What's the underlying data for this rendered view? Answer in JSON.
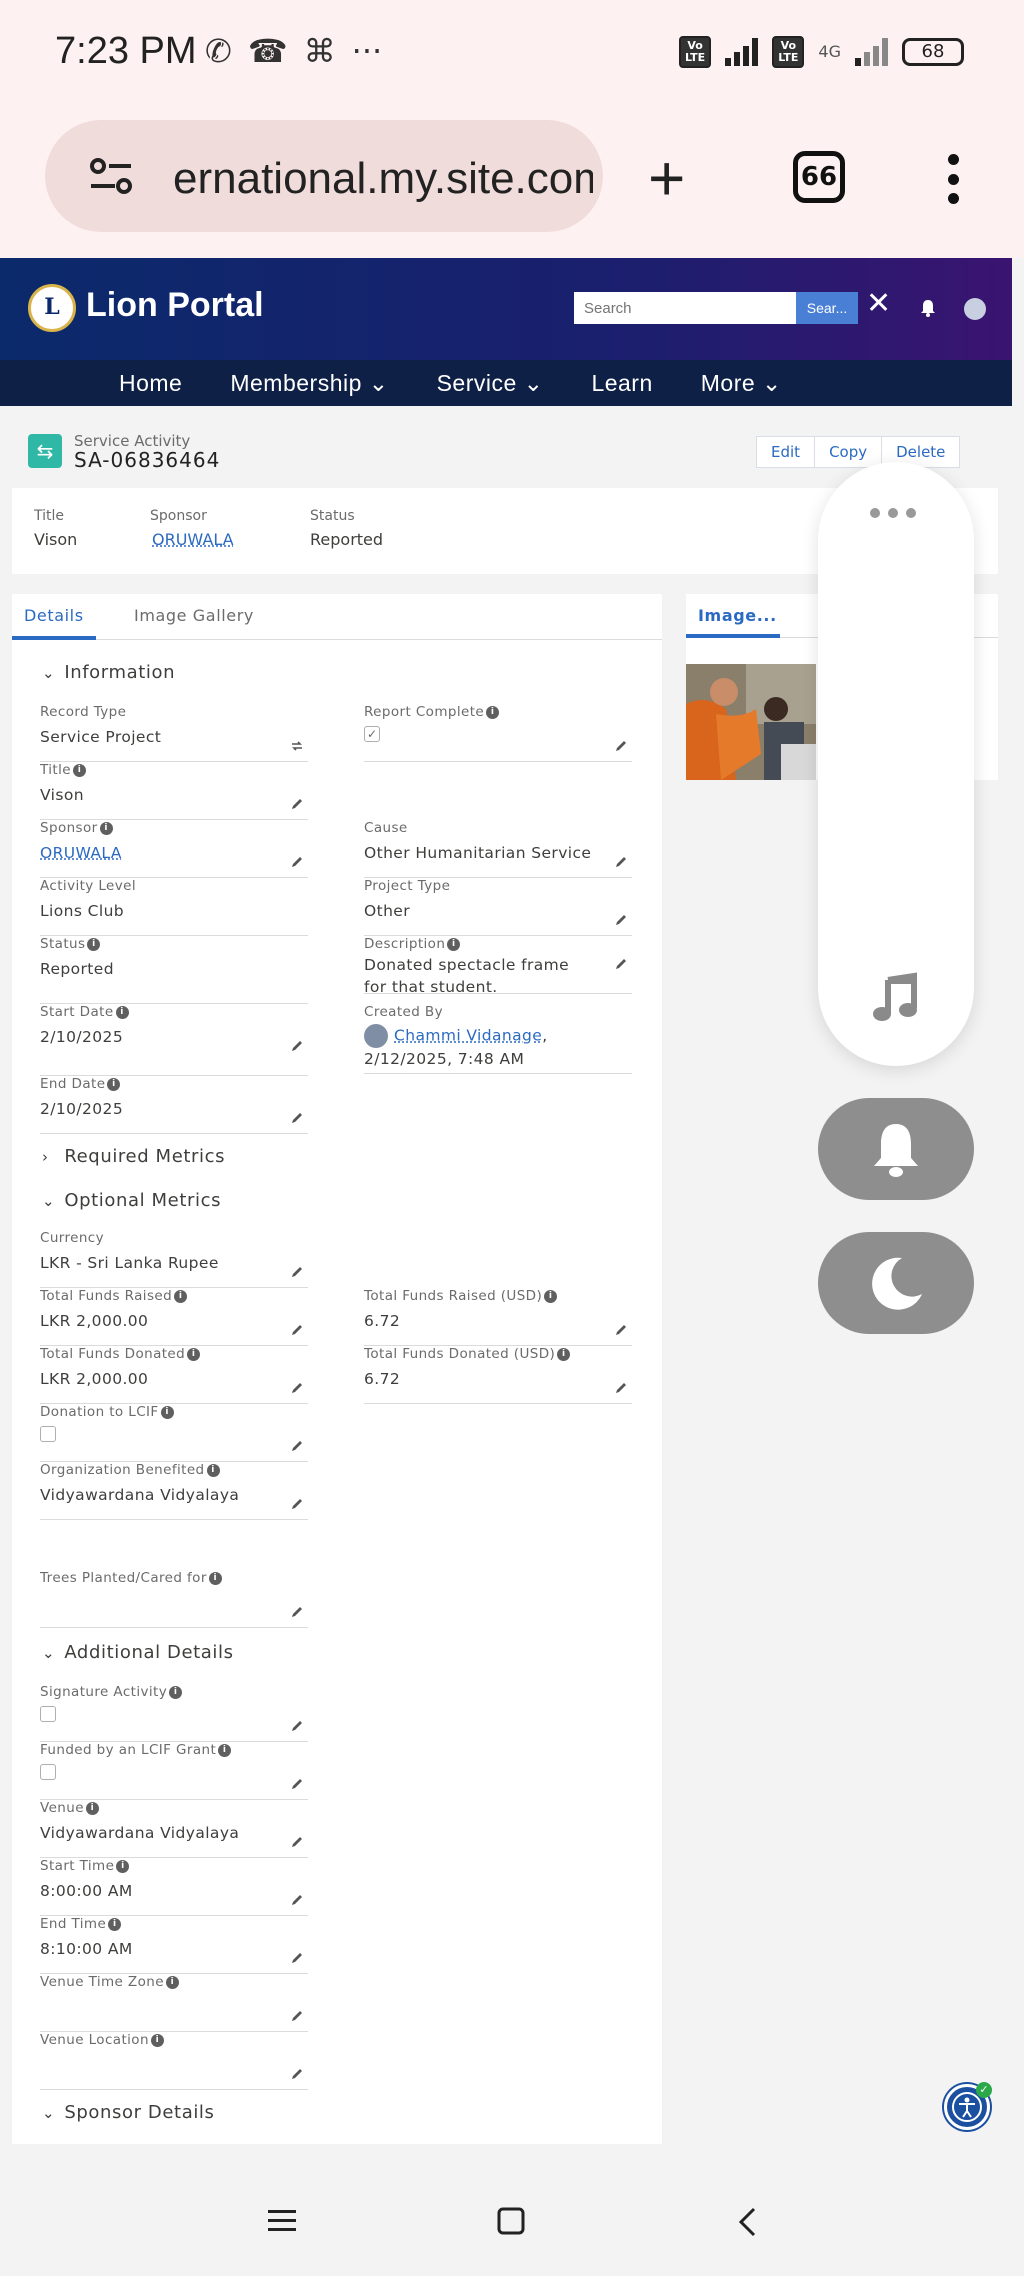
{
  "status_bar": {
    "time": "7:23 PM",
    "battery": "68",
    "network_label": "4G",
    "volte": "Vo LTE"
  },
  "browser": {
    "url": "ernational.my.site.com",
    "tab_count": "66",
    "icons": [
      "tune-icon",
      "plus-icon",
      "tabs-icon",
      "kebab-menu-icon"
    ]
  },
  "portal": {
    "logo_text": "Lion Portal",
    "search_placeholder": "Search",
    "search_button": "Sear...",
    "nav": [
      "Home",
      "Membership ⌄",
      "Service ⌄",
      "Learn",
      "More ⌄"
    ]
  },
  "record": {
    "type": "Service Activity",
    "name": "SA-06836464",
    "actions": [
      "Edit",
      "Copy",
      "Delete"
    ],
    "highlights": [
      {
        "label": "Title",
        "value": "Vison"
      },
      {
        "label": "Sponsor",
        "value": "ORUWALA"
      },
      {
        "label": "Status",
        "value": "Reported"
      }
    ]
  },
  "tabs": {
    "details": "Details",
    "gallery": "Image Gallery",
    "image_panel": "Image..."
  },
  "sections": {
    "information": "Information",
    "required": "Required Metrics",
    "optional": "Optional Metrics",
    "additional": "Additional Details",
    "sponsor": "Sponsor Details"
  },
  "fields": {
    "record_type": {
      "label": "Record Type",
      "value": "Service Project"
    },
    "report_complete": {
      "label": "Report Complete"
    },
    "title": {
      "label": "Title",
      "value": "Vison"
    },
    "sponsor": {
      "label": "Sponsor",
      "value": "ORUWALA"
    },
    "cause": {
      "label": "Cause",
      "value": "Other Humanitarian Service"
    },
    "activity_level": {
      "label": "Activity Level",
      "value": "Lions Club"
    },
    "project_type": {
      "label": "Project Type",
      "value": "Other"
    },
    "status": {
      "label": "Status",
      "value": "Reported"
    },
    "description": {
      "label": "Description",
      "value": "Donated spectacle frame for that student."
    },
    "start_date": {
      "label": "Start Date",
      "value": "2/10/2025"
    },
    "created_by": {
      "label": "Created By",
      "user": "Chammi Vidanage",
      "when": ", 2/12/2025, 7:48 AM"
    },
    "end_date": {
      "label": "End Date",
      "value": "2/10/2025"
    },
    "currency": {
      "label": "Currency",
      "value": "LKR - Sri Lanka Rupee"
    },
    "funds_raised": {
      "label": "Total Funds Raised",
      "value": "LKR 2,000.00"
    },
    "funds_raised_usd": {
      "label": "Total Funds Raised (USD)",
      "value": "6.72"
    },
    "funds_donated": {
      "label": "Total Funds Donated",
      "value": "LKR 2,000.00"
    },
    "funds_donated_usd": {
      "label": "Total Funds Donated (USD)",
      "value": "6.72"
    },
    "donation_lcif": {
      "label": "Donation to LCIF"
    },
    "org_benefited": {
      "label": "Organization Benefited",
      "value": "Vidyawardana Vidyalaya"
    },
    "trees": {
      "label": "Trees Planted/Cared for"
    },
    "signature": {
      "label": "Signature Activity"
    },
    "lcif_grant": {
      "label": "Funded by an LCIF Grant"
    },
    "venue": {
      "label": "Venue",
      "value": "Vidyawardana Vidyalaya"
    },
    "start_time": {
      "label": "Start Time",
      "value": "8:00:00 AM"
    },
    "end_time": {
      "label": "End Time",
      "value": "8:10:00 AM"
    },
    "venue_tz": {
      "label": "Venue Time Zone"
    },
    "venue_location": {
      "label": "Venue Location"
    }
  },
  "colors": {
    "header_start": "#0b2a6b",
    "header_end": "#3a1470",
    "nav_bg": "#0f2046",
    "link": "#2a6ac2",
    "record_icon": "#2fb8a6"
  }
}
